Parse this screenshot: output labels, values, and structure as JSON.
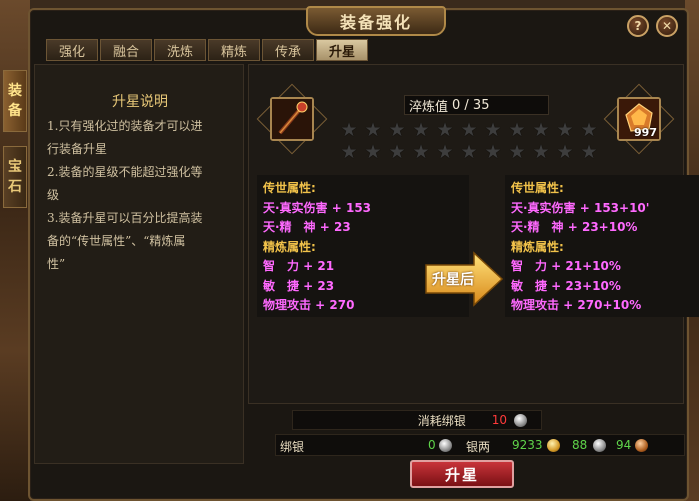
{
  "window": {
    "title": "装备强化",
    "help_glyph": "?",
    "close_glyph": "✕"
  },
  "tabs": [
    {
      "label": "强化"
    },
    {
      "label": "融合"
    },
    {
      "label": "洗炼"
    },
    {
      "label": "精炼"
    },
    {
      "label": "传承"
    },
    {
      "label": "升星",
      "active": true
    }
  ],
  "side_tabs": [
    {
      "label1": "装",
      "label2": "备",
      "active": true
    },
    {
      "label1": "宝",
      "label2": "石",
      "active": false
    }
  ],
  "description": {
    "title": "升星说明",
    "lines": [
      "1.只有强化过的装备才可以进",
      "行装备升星",
      "2.装备的星级不能超过强化等",
      "级",
      "3.装备升星可以百分比提高装",
      "备的“传世属性”、“精炼属",
      "性”"
    ]
  },
  "equipment": {
    "weapon_icon": "staff-icon",
    "material_icon": "ore-icon",
    "material_count": "997"
  },
  "progress": {
    "label": "淬炼值",
    "value": "0 / 35",
    "fraction": 0
  },
  "stars": {
    "total": 22,
    "lit": 0,
    "glyph": "★"
  },
  "current_attrs": {
    "lines": [
      {
        "text": "传世属性:",
        "kind": "head"
      },
      {
        "text": "天·真实伤害 + 153",
        "kind": "item"
      },
      {
        "text": "天·精　神 + 23",
        "kind": "item"
      },
      {
        "text": "精炼属性:",
        "kind": "head"
      },
      {
        "text": "智　力 + 21",
        "kind": "item"
      },
      {
        "text": "敏　捷 + 23",
        "kind": "item"
      },
      {
        "text": "物理攻击 + 270",
        "kind": "item"
      }
    ]
  },
  "after_attrs": {
    "lines": [
      {
        "text": "传世属性:",
        "kind": "head"
      },
      {
        "text": "天·真实伤害 + 153+10'",
        "kind": "item"
      },
      {
        "text": "天·精　神 + 23+10%",
        "kind": "item"
      },
      {
        "text": "精炼属性:",
        "kind": "head"
      },
      {
        "text": "智　力 + 21+10%",
        "kind": "item"
      },
      {
        "text": "敏　捷 + 23+10%",
        "kind": "item"
      },
      {
        "text": "物理攻击 + 270+10%",
        "kind": "item"
      }
    ]
  },
  "arrow": {
    "label": "升星后"
  },
  "cost": {
    "label": "消耗绑银",
    "value": "10"
  },
  "money": {
    "bound_label": "绑银",
    "bound_value": "0",
    "silver_label": "银两",
    "gold_value": "9233",
    "silver_value": "88",
    "copper_value": "94"
  },
  "buttons": {
    "upgrade": "升星"
  },
  "colors": {
    "attr_head": "#f1c24a",
    "attr_item": "#ff69ff",
    "cost_red": "#ff3a3a",
    "money_green": "#5fd44a"
  }
}
